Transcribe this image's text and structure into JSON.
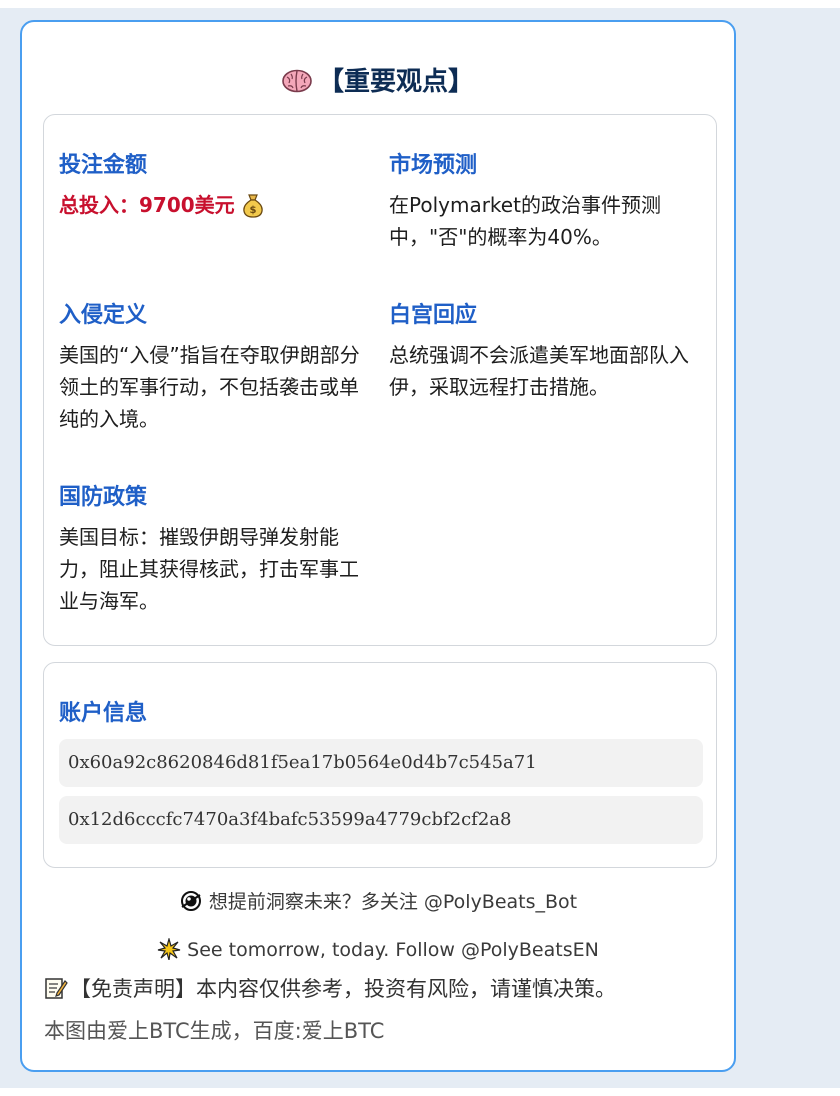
{
  "header": {
    "title": "【重要观点】",
    "icon": "brain-icon"
  },
  "views": {
    "bet_amount": {
      "heading": "投注金额",
      "total_text": "总投入：9700美元",
      "icon": "money-bag-icon",
      "total_color": "#c8102e"
    },
    "market_forecast": {
      "heading": "市场预测",
      "body": "在Polymarket的政治事件预测中，\"否\"的概率为40%。"
    },
    "invasion_definition": {
      "heading": "入侵定义",
      "body": "美国的“入侵”指旨在夺取伊朗部分领土的军事行动，不包括袭击或单纯的入境。"
    },
    "white_house_response": {
      "heading": "白宫回应",
      "body": "总统强调不会派遣美军地面部队入伊，采取远程打击措施。"
    },
    "defense_policy": {
      "heading": "国防政策",
      "body": "美国目标：摧毁伊朗导弹发射能力，阻止其获得核武，打击军事工业与海军。"
    },
    "heading_color": "#1f5fc7"
  },
  "account": {
    "heading": "账户信息",
    "addresses": [
      "0x60a92c8620846d81f5ea17b0564e0d4b7c545a71",
      "0x12d6cccfc7470a3f4bafc53599a4779cbf2cf2a8"
    ]
  },
  "footer": {
    "cn_line": "想提前洞察未来？多关注 @PolyBeats_Bot",
    "cn_icon": "crystal-ball-icon",
    "en_line": "See tomorrow, today. Follow @PolyBeatsEN",
    "en_icon": "sparkle-burst-icon",
    "disclaimer": "【免责声明】本内容仅供参考，投资有风险，请谨慎决策。",
    "disclaimer_icon": "memo-icon",
    "credit": "本图由爱上BTC生成，百度:爱上BTC"
  },
  "colors": {
    "card_border": "#4a9ef0",
    "title": "#0d2c54",
    "page_background": "#e5ecf4"
  }
}
